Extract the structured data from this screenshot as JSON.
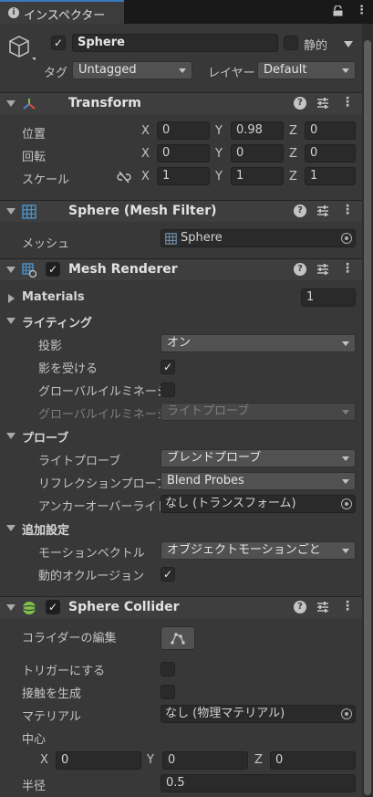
{
  "tab": {
    "title": "インスペクター"
  },
  "object": {
    "name": "Sphere",
    "static_label": "静的",
    "tag_label": "タグ",
    "tag_value": "Untagged",
    "layer_label": "レイヤー",
    "layer_value": "Default"
  },
  "transform": {
    "title": "Transform",
    "position_label": "位置",
    "rotation_label": "回転",
    "scale_label": "スケール",
    "axis_x": "X",
    "axis_y": "Y",
    "axis_z": "Z",
    "position": {
      "x": "0",
      "y": "0.98",
      "z": "0"
    },
    "rotation": {
      "x": "0",
      "y": "0",
      "z": "0"
    },
    "scale": {
      "x": "1",
      "y": "1",
      "z": "1"
    }
  },
  "mesh_filter": {
    "title": "Sphere (Mesh Filter)",
    "mesh_label": "メッシュ",
    "mesh_value": "Sphere"
  },
  "mesh_renderer": {
    "title": "Mesh Renderer",
    "materials_label": "Materials",
    "materials_count": "1",
    "lighting_label": "ライティング",
    "cast_shadows_label": "投影",
    "cast_shadows_value": "オン",
    "receive_shadows_label": "影を受ける",
    "gi_label": "グローバルイルミネーシ",
    "gi2_label": "グローバルイルミネーシ",
    "gi2_value": "ライトプローブ",
    "probes_label": "プローブ",
    "light_probes_label": "ライトプローブ",
    "light_probes_value": "ブレンドプローブ",
    "reflection_probes_label": "リフレクションプローブ",
    "reflection_probes_value": "Blend Probes",
    "anchor_label": "アンカーオーバーライド",
    "anchor_value": "なし (トランスフォーム)",
    "additional_label": "追加設定",
    "motion_vectors_label": "モーションベクトル",
    "motion_vectors_value": "オブジェクトモーションごと",
    "dynamic_occlusion_label": "動的オクルージョン"
  },
  "sphere_collider": {
    "title": "Sphere Collider",
    "edit_collider_label": "コライダーの編集",
    "is_trigger_label": "トリガーにする",
    "provides_contacts_label": "接触を生成",
    "material_label": "マテリアル",
    "material_value": "なし (物理マテリアル)",
    "center_label": "中心",
    "center": {
      "x": "0",
      "y": "0",
      "z": "0"
    },
    "radius_label": "半径",
    "radius_value": "0.5"
  },
  "icons": [
    "info-icon",
    "lock-icon",
    "menu-icon",
    "gameobject-cube-icon",
    "transform-axes-icon",
    "mesh-filter-grid-icon",
    "mesh-renderer-icon",
    "sphere-collider-icon",
    "help-icon",
    "preset-icon",
    "more-icon",
    "link-scale-icon",
    "object-picker-icon",
    "edit-collider-icon"
  ],
  "colors": {
    "background": "#383838",
    "header": "#3e3e3e",
    "field": "#2a2a2a",
    "tab_accent": "#3a79bb",
    "collider_icon": "#7ec24c"
  }
}
